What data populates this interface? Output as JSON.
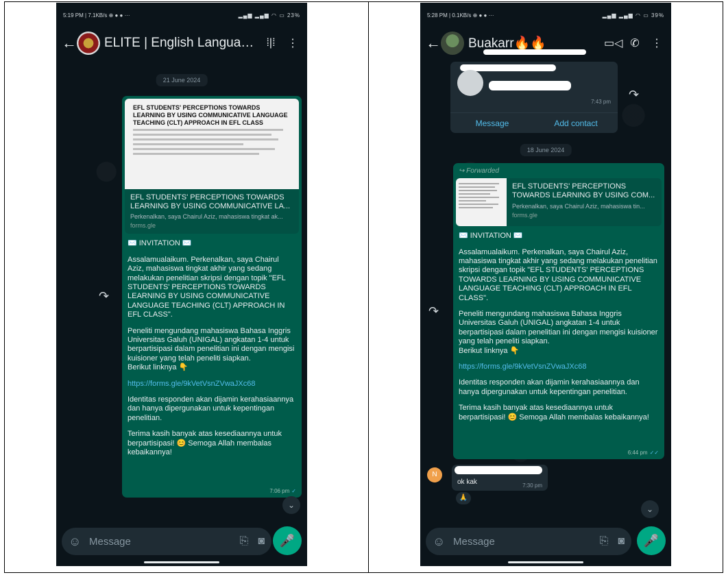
{
  "left": {
    "status": {
      "time": "5:19 PM",
      "net": "7.1KB/s",
      "battery": "23%"
    },
    "chat_title": "ELITE | English Language...",
    "date_chip": "21 June 2024",
    "preview": {
      "image_title": "EFL STUDENTS' PERCEPTIONS TOWARDS LEARNING BY USING COMMUNICATIVE LANGUAGE TEACHING (CLT) APPROACH IN EFL CLASS",
      "title": "EFL STUDENTS' PERCEPTIONS TOWARDS LEARNING BY USING COMMUNICATIVE LA...",
      "desc": "Perkenalkan, saya Chairul Aziz, mahasiswa tingkat ak...",
      "domain": "forms.gle"
    },
    "message": {
      "invitation": "✉️ INVITATION ✉️",
      "p1": "Assalamualaikum. Perkenalkan, saya Chairul Aziz, mahasiswa tingkat akhir yang sedang melakukan penelitian skripsi dengan topik \"EFL STUDENTS' PERCEPTIONS TOWARDS LEARNING BY USING COMMUNICATIVE LANGUAGE TEACHING (CLT) APPROACH IN EFL CLASS\".",
      "p2": "Peneliti mengundang mahasiswa Bahasa Inggris Universitas Galuh (UNIGAL) angkatan 1-4 untuk berpartisipasi dalam penelitian ini dengan mengisi kuisioner yang telah peneliti siapkan.",
      "p2b": "Berikut linknya 👇",
      "link": "https://forms.gle/9kVetVsnZVwaJXc68",
      "p3": "Identitas responden akan dijamin kerahasiaannya dan hanya dipergunakan untuk kepentingan penelitian.",
      "p4": "Terima kasih banyak atas kesediaannya untuk berpartisipasi! 😊 Semoga Allah membalas kebaikannya!",
      "time": "7:06 pm"
    },
    "input_placeholder": "Message"
  },
  "right": {
    "status": {
      "time": "5:28 PM",
      "net": "0.1KB/s",
      "battery": "39%"
    },
    "chat_title": "Buakarr🔥🔥",
    "contact_card": {
      "time": "7:43 pm",
      "btn_message": "Message",
      "btn_add": "Add contact"
    },
    "date_chip": "18 June 2024",
    "forwarded_label": "Forwarded",
    "preview": {
      "title": "EFL STUDENTS' PERCEPTIONS TOWARDS LEARNING BY USING COM...",
      "desc": "Perkenalkan, saya Chairul Aziz, mahasiswa tin...",
      "domain": "forms.gle"
    },
    "message": {
      "invitation": "✉️ INVITATION ✉️",
      "p1": "Assalamualaikum. Perkenalkan, saya Chairul Aziz, mahasiswa tingkat akhir yang sedang melakukan penelitian skripsi dengan topik \"EFL STUDENTS' PERCEPTIONS TOWARDS LEARNING BY USING COMMUNICATIVE LANGUAGE TEACHING (CLT) APPROACH IN EFL CLASS\".",
      "p2": "Peneliti mengundang mahasiswa Bahasa Inggris Universitas Galuh (UNIGAL) angkatan 1-4 untuk berpartisipasi dalam penelitian ini dengan mengisi kuisioner yang telah peneliti siapkan.",
      "p2b": "Berikut linknya 👇",
      "link": "https://forms.gle/9kVetVsnZVwaJXc68",
      "p3": "Identitas responden akan dijamin kerahasiaannya dan hanya dipergunakan untuk kepentingan penelitian.",
      "p4": "Terima kasih banyak atas kesediaannya untuk berpartisipasi! 😊 Semoga Allah membalas kebaikannya!",
      "time": "6:44 pm"
    },
    "reply": {
      "avatar_letter": "N",
      "text": "ok kak",
      "time": "7:30 pm",
      "reaction": "🙏"
    },
    "input_placeholder": "Message"
  },
  "icons": {
    "back": "arrow-back-icon",
    "more": "more-vert-icon",
    "share": "forward-share-icon",
    "emoji": "emoji-icon",
    "attach": "attach-icon",
    "camera": "camera-icon",
    "mic": "mic-icon"
  }
}
